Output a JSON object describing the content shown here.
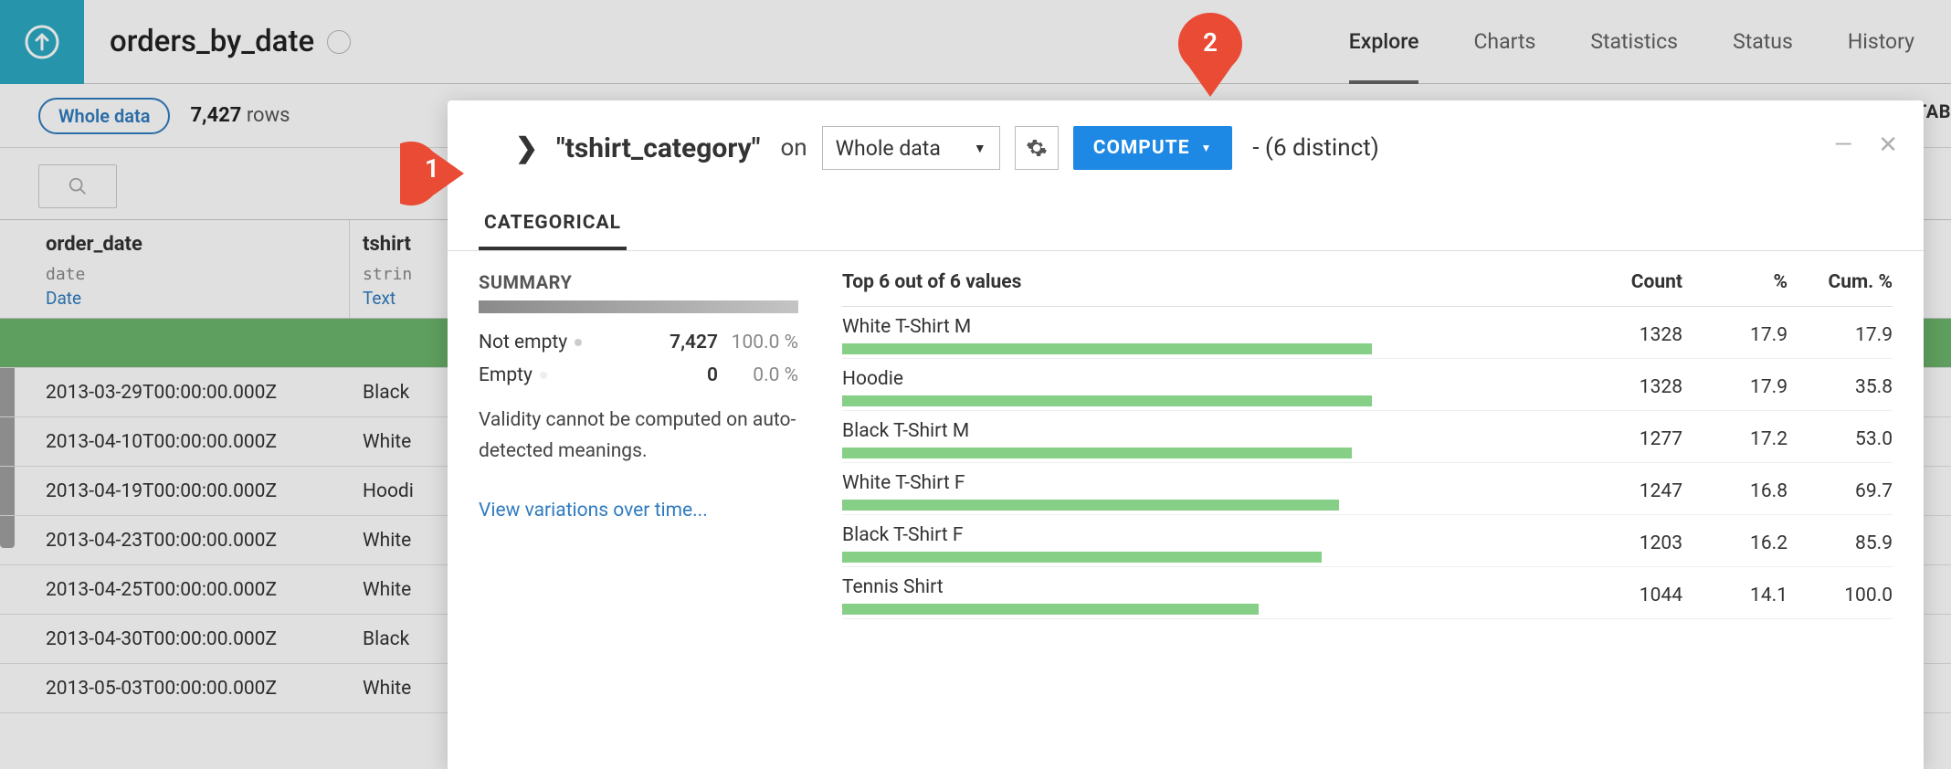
{
  "header": {
    "title": "orders_by_date",
    "nav": {
      "explore": "Explore",
      "charts": "Charts",
      "statistics": "Statistics",
      "status": "Status",
      "history": "History"
    }
  },
  "subheader": {
    "pill": "Whole data",
    "rows_value": "7,427",
    "rows_label": "rows",
    "tab_label": "TAB"
  },
  "table": {
    "col1": {
      "name": "order_date",
      "type": "date",
      "meaning": "Date"
    },
    "col2": {
      "name": "tshirt",
      "type": "strin",
      "meaning": "Text"
    },
    "rows": [
      {
        "c1": "",
        "c2": ""
      },
      {
        "c1": "2013-03-29T00:00:00.000Z",
        "c2": "Black"
      },
      {
        "c1": "2013-04-10T00:00:00.000Z",
        "c2": "White"
      },
      {
        "c1": "2013-04-19T00:00:00.000Z",
        "c2": "Hoodi"
      },
      {
        "c1": "2013-04-23T00:00:00.000Z",
        "c2": "White"
      },
      {
        "c1": "2013-04-25T00:00:00.000Z",
        "c2": "White"
      },
      {
        "c1": "2013-04-30T00:00:00.000Z",
        "c2": "Black"
      },
      {
        "c1": "2013-05-03T00:00:00.000Z",
        "c2": "White"
      }
    ]
  },
  "panel": {
    "column_name": "\"tshirt_category\"",
    "on_label": "on",
    "scope_dd": "Whole data",
    "compute_label": "COMPUTE",
    "distinct": "- (6 distinct)",
    "tab": "CATEGORICAL",
    "summary": {
      "title": "SUMMARY",
      "not_empty_label": "Not empty",
      "not_empty_value": "7,427",
      "not_empty_pct": "100.0 %",
      "empty_label": "Empty",
      "empty_value": "0",
      "empty_pct": "0.0 %",
      "note": "Validity cannot be computed on auto-detected meanings.",
      "link": "View variations over time..."
    },
    "values": {
      "header": {
        "label": "Top 6 out of 6 values",
        "count": "Count",
        "pct": "%",
        "cum": "Cum. %"
      },
      "items": [
        {
          "name": "White T-Shirt M",
          "count": "1328",
          "pct": "17.9",
          "cum": "17.9"
        },
        {
          "name": "Hoodie",
          "count": "1328",
          "pct": "17.9",
          "cum": "35.8"
        },
        {
          "name": "Black T-Shirt M",
          "count": "1277",
          "pct": "17.2",
          "cum": "53.0"
        },
        {
          "name": "White T-Shirt F",
          "count": "1247",
          "pct": "16.8",
          "cum": "69.7"
        },
        {
          "name": "Black T-Shirt F",
          "count": "1203",
          "pct": "16.2",
          "cum": "85.9"
        },
        {
          "name": "Tennis Shirt",
          "count": "1044",
          "pct": "14.1",
          "cum": "100.0"
        }
      ]
    }
  },
  "pins": {
    "one": "1",
    "two": "2"
  },
  "chart_data": {
    "type": "bar",
    "title": "Top 6 out of 6 values",
    "categories": [
      "White T-Shirt M",
      "Hoodie",
      "Black T-Shirt M",
      "White T-Shirt F",
      "Black T-Shirt F",
      "Tennis Shirt"
    ],
    "series": [
      {
        "name": "Count",
        "values": [
          1328,
          1328,
          1277,
          1247,
          1203,
          1044
        ]
      },
      {
        "name": "%",
        "values": [
          17.9,
          17.9,
          17.2,
          16.8,
          16.2,
          14.1
        ]
      },
      {
        "name": "Cum. %",
        "values": [
          17.9,
          35.8,
          53.0,
          69.7,
          85.9,
          100.0
        ]
      }
    ]
  }
}
